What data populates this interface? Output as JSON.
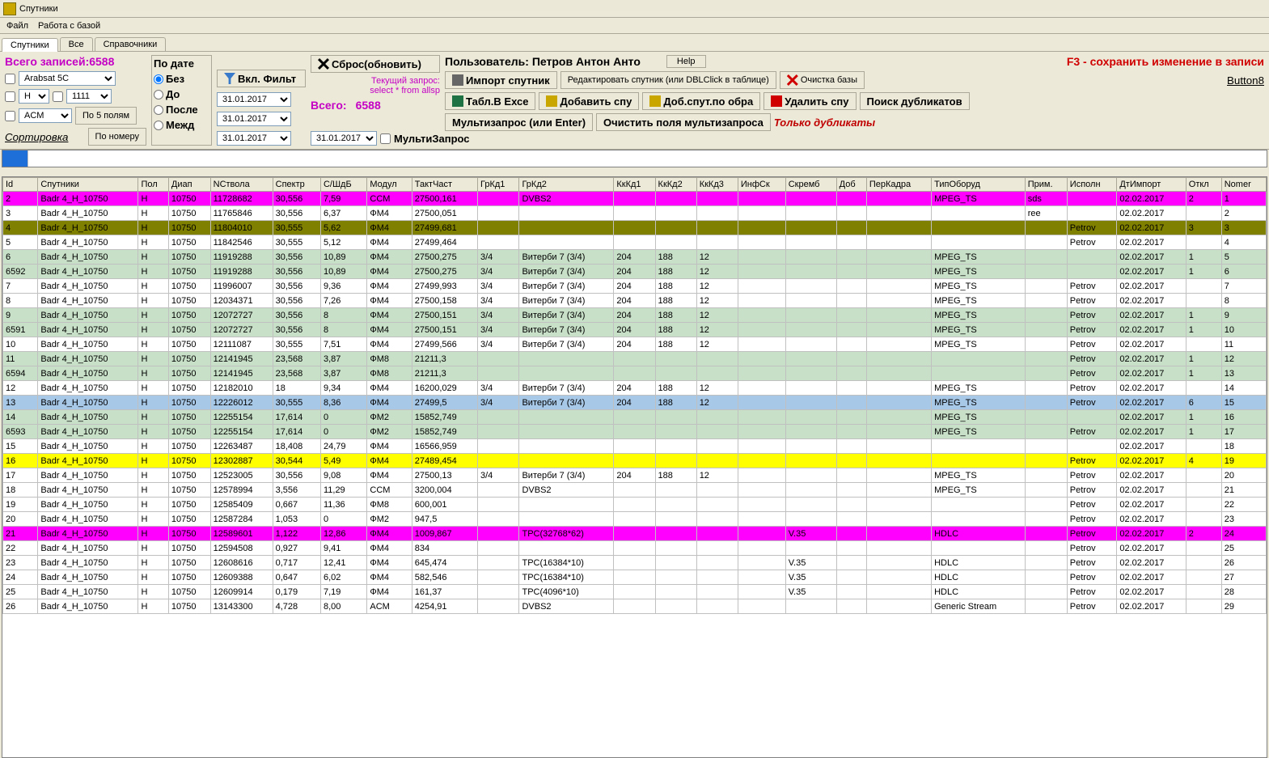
{
  "window": {
    "title": "Спутники"
  },
  "menu": {
    "file": "Файл",
    "db": "Работа с базой"
  },
  "tabs": [
    "Спутники",
    "Все",
    "Справочники"
  ],
  "summary": {
    "total_label": "Всего записей:",
    "total_value": "6588",
    "total2_label": "Всего:",
    "total2_value": "6588"
  },
  "filters": {
    "combo1": "Arabsat 5C",
    "combo2": "H",
    "combo3": "1111",
    "combo4": "ACM",
    "by5": "По 5 полям",
    "sort": "Сортировка",
    "by_num": "По номеру"
  },
  "date_filter": {
    "title": "По дате",
    "none": "Без",
    "before": "До",
    "after": "После",
    "between": "Межд",
    "d1": "31.01.2017",
    "d2": "31.01.2017",
    "d3": "31.01.2017",
    "d4": "31.01.2017"
  },
  "btns": {
    "enable_filter": "Вкл. Фильт",
    "reset": "Сброс(обновить)",
    "multiquery": "МультиЗапрос",
    "user_label": "Пользователь: Петров Антон Анто",
    "help": "Help",
    "hint": "F3 - сохранить изменение в записи",
    "query1": "Текущий запрос:",
    "query2": "select * from allsp",
    "import": "Импорт спутник",
    "edit_sat": "Редактировать спутник (или DBLClick в таблице)",
    "clear_db": "Очистка базы",
    "button8": "Button8",
    "to_excel": "Табл.В Ехсе",
    "add_sat": "Добавить спу",
    "add_by_sample": "Доб.спут.по обра",
    "delete_sat": "Удалить спу",
    "find_dup": "Поиск дубликатов",
    "only_dup": "Только дубликаты",
    "multiquery2": "Мультизапрос (или Enter)",
    "clear_fields": "Очистить поля мультизапроса"
  },
  "headers": [
    "Id",
    "Спутники",
    "Пол",
    "Диап",
    "NСтвола",
    "Спектр",
    "С/ШдБ",
    "Модул",
    "ТактЧаст",
    "ГрКд1",
    "ГрКд2",
    "КкКд1",
    "КкКд2",
    "КкКд3",
    "ИнфСк",
    "Скремб",
    "Доб",
    "ПерКадра",
    "ТипОборуд",
    "Прим.",
    "Исполн",
    "ДтИмпорт",
    "Откл",
    "Nomer"
  ],
  "rows": [
    {
      "c": "magenta-row",
      "d": [
        "2",
        "Badr 4_H_10750",
        "H",
        "10750",
        "11728682",
        "30,556",
        "7,59",
        "CCM",
        "27500,161",
        "",
        "DVBS2",
        "",
        "",
        "",
        "",
        "",
        "",
        "",
        "MPEG_TS",
        "sds",
        "",
        "02.02.2017",
        "2",
        "1"
      ]
    },
    {
      "c": "",
      "d": [
        "3",
        "Badr 4_H_10750",
        "H",
        "10750",
        "11765846",
        "30,556",
        "6,37",
        "ФМ4",
        "27500,051",
        "",
        "",
        "",
        "",
        "",
        "",
        "",
        "",
        "",
        "",
        "ree",
        "",
        "02.02.2017",
        "",
        "2"
      ]
    },
    {
      "c": "olive-row",
      "d": [
        "4",
        "Badr 4_H_10750",
        "H",
        "10750",
        "11804010",
        "30,555",
        "5,62",
        "ФМ4",
        "27499,681",
        "",
        "",
        "",
        "",
        "",
        "",
        "",
        "",
        "",
        "",
        "",
        "Petrov",
        "02.02.2017",
        "3",
        "3"
      ]
    },
    {
      "c": "",
      "d": [
        "5",
        "Badr 4_H_10750",
        "H",
        "10750",
        "11842546",
        "30,555",
        "5,12",
        "ФМ4",
        "27499,464",
        "",
        "",
        "",
        "",
        "",
        "",
        "",
        "",
        "",
        "",
        "",
        "Petrov",
        "02.02.2017",
        "",
        "4"
      ]
    },
    {
      "c": "green-row",
      "d": [
        "6",
        "Badr 4_H_10750",
        "H",
        "10750",
        "11919288",
        "30,556",
        "10,89",
        "ФМ4",
        "27500,275",
        "3/4",
        "Витерби 7 (3/4)",
        "204",
        "188",
        "12",
        "",
        "",
        "",
        "",
        "MPEG_TS",
        "",
        "",
        "02.02.2017",
        "1",
        "5"
      ]
    },
    {
      "c": "green-row",
      "d": [
        "6592",
        "Badr 4_H_10750",
        "H",
        "10750",
        "11919288",
        "30,556",
        "10,89",
        "ФМ4",
        "27500,275",
        "3/4",
        "Витерби 7 (3/4)",
        "204",
        "188",
        "12",
        "",
        "",
        "",
        "",
        "MPEG_TS",
        "",
        "",
        "02.02.2017",
        "1",
        "6"
      ]
    },
    {
      "c": "",
      "d": [
        "7",
        "Badr 4_H_10750",
        "H",
        "10750",
        "11996007",
        "30,556",
        "9,36",
        "ФМ4",
        "27499,993",
        "3/4",
        "Витерби 7 (3/4)",
        "204",
        "188",
        "12",
        "",
        "",
        "",
        "",
        "MPEG_TS",
        "",
        "Petrov",
        "02.02.2017",
        "",
        "7"
      ]
    },
    {
      "c": "",
      "d": [
        "8",
        "Badr 4_H_10750",
        "H",
        "10750",
        "12034371",
        "30,556",
        "7,26",
        "ФМ4",
        "27500,158",
        "3/4",
        "Витерби 7 (3/4)",
        "204",
        "188",
        "12",
        "",
        "",
        "",
        "",
        "MPEG_TS",
        "",
        "Petrov",
        "02.02.2017",
        "",
        "8"
      ]
    },
    {
      "c": "green-row",
      "d": [
        "9",
        "Badr 4_H_10750",
        "H",
        "10750",
        "12072727",
        "30,556",
        "8",
        "ФМ4",
        "27500,151",
        "3/4",
        "Витерби 7 (3/4)",
        "204",
        "188",
        "12",
        "",
        "",
        "",
        "",
        "MPEG_TS",
        "",
        "Petrov",
        "02.02.2017",
        "1",
        "9"
      ]
    },
    {
      "c": "green-row",
      "d": [
        "6591",
        "Badr 4_H_10750",
        "H",
        "10750",
        "12072727",
        "30,556",
        "8",
        "ФМ4",
        "27500,151",
        "3/4",
        "Витерби 7 (3/4)",
        "204",
        "188",
        "12",
        "",
        "",
        "",
        "",
        "MPEG_TS",
        "",
        "Petrov",
        "02.02.2017",
        "1",
        "10"
      ]
    },
    {
      "c": "",
      "d": [
        "10",
        "Badr 4_H_10750",
        "H",
        "10750",
        "12111087",
        "30,555",
        "7,51",
        "ФМ4",
        "27499,566",
        "3/4",
        "Витерби 7 (3/4)",
        "204",
        "188",
        "12",
        "",
        "",
        "",
        "",
        "MPEG_TS",
        "",
        "Petrov",
        "02.02.2017",
        "",
        "11"
      ]
    },
    {
      "c": "green-row",
      "d": [
        "11",
        "Badr 4_H_10750",
        "H",
        "10750",
        "12141945",
        "23,568",
        "3,87",
        "ФМ8",
        "21211,3",
        "",
        "",
        "",
        "",
        "",
        "",
        "",
        "",
        "",
        "",
        "",
        "Petrov",
        "02.02.2017",
        "1",
        "12"
      ]
    },
    {
      "c": "green-row",
      "d": [
        "6594",
        "Badr 4_H_10750",
        "H",
        "10750",
        "12141945",
        "23,568",
        "3,87",
        "ФМ8",
        "21211,3",
        "",
        "",
        "",
        "",
        "",
        "",
        "",
        "",
        "",
        "",
        "",
        "Petrov",
        "02.02.2017",
        "1",
        "13"
      ]
    },
    {
      "c": "",
      "d": [
        "12",
        "Badr 4_H_10750",
        "H",
        "10750",
        "12182010",
        "18",
        "9,34",
        "ФМ4",
        "16200,029",
        "3/4",
        "Витерби 7 (3/4)",
        "204",
        "188",
        "12",
        "",
        "",
        "",
        "",
        "MPEG_TS",
        "",
        "Petrov",
        "02.02.2017",
        "",
        "14"
      ]
    },
    {
      "c": "blue-row",
      "d": [
        "13",
        "Badr 4_H_10750",
        "H",
        "10750",
        "12226012",
        "30,555",
        "8,36",
        "ФМ4",
        "27499,5",
        "3/4",
        "Витерби 7 (3/4)",
        "204",
        "188",
        "12",
        "",
        "",
        "",
        "",
        "MPEG_TS",
        "",
        "Petrov",
        "02.02.2017",
        "6",
        "15"
      ]
    },
    {
      "c": "green-row",
      "d": [
        "14",
        "Badr 4_H_10750",
        "H",
        "10750",
        "12255154",
        "17,614",
        "0",
        "ФМ2",
        "15852,749",
        "",
        "",
        "",
        "",
        "",
        "",
        "",
        "",
        "",
        "MPEG_TS",
        "",
        "",
        "02.02.2017",
        "1",
        "16"
      ]
    },
    {
      "c": "green-row",
      "d": [
        "6593",
        "Badr 4_H_10750",
        "H",
        "10750",
        "12255154",
        "17,614",
        "0",
        "ФМ2",
        "15852,749",
        "",
        "",
        "",
        "",
        "",
        "",
        "",
        "",
        "",
        "MPEG_TS",
        "",
        "Petrov",
        "02.02.2017",
        "1",
        "17"
      ]
    },
    {
      "c": "",
      "d": [
        "15",
        "Badr 4_H_10750",
        "H",
        "10750",
        "12263487",
        "18,408",
        "24,79",
        "ФМ4",
        "16566,959",
        "",
        "",
        "",
        "",
        "",
        "",
        "",
        "",
        "",
        "",
        "",
        "",
        "02.02.2017",
        "",
        "18"
      ]
    },
    {
      "c": "yellow-row",
      "d": [
        "16",
        "Badr 4_H_10750",
        "H",
        "10750",
        "12302887",
        "30,544",
        "5,49",
        "ФМ4",
        "27489,454",
        "",
        "",
        "",
        "",
        "",
        "",
        "",
        "",
        "",
        "",
        "",
        "Petrov",
        "02.02.2017",
        "4",
        "19"
      ]
    },
    {
      "c": "",
      "d": [
        "17",
        "Badr 4_H_10750",
        "H",
        "10750",
        "12523005",
        "30,556",
        "9,08",
        "ФМ4",
        "27500,13",
        "3/4",
        "Витерби 7 (3/4)",
        "204",
        "188",
        "12",
        "",
        "",
        "",
        "",
        "MPEG_TS",
        "",
        "Petrov",
        "02.02.2017",
        "",
        "20"
      ]
    },
    {
      "c": "",
      "d": [
        "18",
        "Badr 4_H_10750",
        "H",
        "10750",
        "12578994",
        "3,556",
        "11,29",
        "CCM",
        "3200,004",
        "",
        "DVBS2",
        "",
        "",
        "",
        "",
        "",
        "",
        "",
        "MPEG_TS",
        "",
        "Petrov",
        "02.02.2017",
        "",
        "21"
      ]
    },
    {
      "c": "",
      "d": [
        "19",
        "Badr 4_H_10750",
        "H",
        "10750",
        "12585409",
        "0,667",
        "11,36",
        "ФМ8",
        "600,001",
        "",
        "",
        "",
        "",
        "",
        "",
        "",
        "",
        "",
        "",
        "",
        "Petrov",
        "02.02.2017",
        "",
        "22"
      ]
    },
    {
      "c": "",
      "d": [
        "20",
        "Badr 4_H_10750",
        "H",
        "10750",
        "12587284",
        "1,053",
        "0",
        "ФМ2",
        "947,5",
        "",
        "",
        "",
        "",
        "",
        "",
        "",
        "",
        "",
        "",
        "",
        "Petrov",
        "02.02.2017",
        "",
        "23"
      ]
    },
    {
      "c": "magenta-row",
      "d": [
        "21",
        "Badr 4_H_10750",
        "H",
        "10750",
        "12589601",
        "1,122",
        "12,86",
        "ФМ4",
        "1009,867",
        "",
        "TPC(32768*62)",
        "",
        "",
        "",
        "",
        "V.35",
        "",
        "",
        "HDLC",
        "",
        "Petrov",
        "02.02.2017",
        "2",
        "24"
      ]
    },
    {
      "c": "",
      "d": [
        "22",
        "Badr 4_H_10750",
        "H",
        "10750",
        "12594508",
        "0,927",
        "9,41",
        "ФМ4",
        "834",
        "",
        "",
        "",
        "",
        "",
        "",
        "",
        "",
        "",
        "",
        "",
        "Petrov",
        "02.02.2017",
        "",
        "25"
      ]
    },
    {
      "c": "",
      "d": [
        "23",
        "Badr 4_H_10750",
        "H",
        "10750",
        "12608616",
        "0,717",
        "12,41",
        "ФМ4",
        "645,474",
        "",
        "TPC(16384*10)",
        "",
        "",
        "",
        "",
        "V.35",
        "",
        "",
        "HDLC",
        "",
        "Petrov",
        "02.02.2017",
        "",
        "26"
      ]
    },
    {
      "c": "",
      "d": [
        "24",
        "Badr 4_H_10750",
        "H",
        "10750",
        "12609388",
        "0,647",
        "6,02",
        "ФМ4",
        "582,546",
        "",
        "TPC(16384*10)",
        "",
        "",
        "",
        "",
        "V.35",
        "",
        "",
        "HDLC",
        "",
        "Petrov",
        "02.02.2017",
        "",
        "27"
      ]
    },
    {
      "c": "",
      "d": [
        "25",
        "Badr 4_H_10750",
        "H",
        "10750",
        "12609914",
        "0,179",
        "7,19",
        "ФМ4",
        "161,37",
        "",
        "TPC(4096*10)",
        "",
        "",
        "",
        "",
        "V.35",
        "",
        "",
        "HDLC",
        "",
        "Petrov",
        "02.02.2017",
        "",
        "28"
      ]
    },
    {
      "c": "",
      "d": [
        "26",
        "Badr 4_H_10750",
        "H",
        "10750",
        "13143300",
        "4,728",
        "8,00",
        "ACM",
        "4254,91",
        "",
        "DVBS2",
        "",
        "",
        "",
        "",
        "",
        "",
        "",
        "Generic Stream",
        "",
        "Petrov",
        "02.02.2017",
        "",
        "29"
      ]
    }
  ]
}
